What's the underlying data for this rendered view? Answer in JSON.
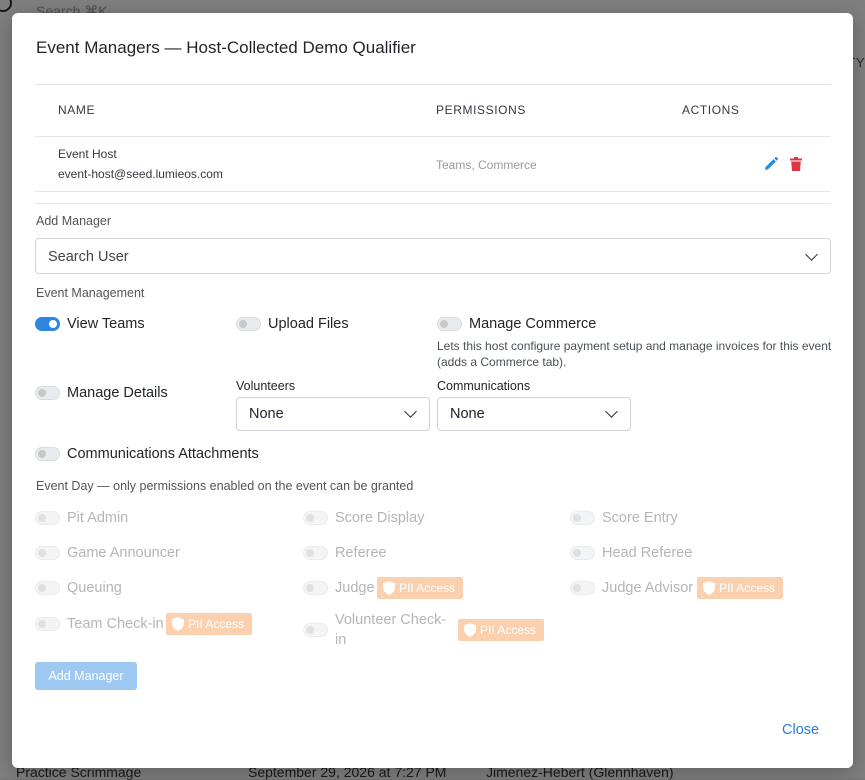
{
  "background": {
    "search_placeholder": "Search ⌘K",
    "col_header": "TY",
    "bottom_row": {
      "name": "Practice Scrimmage",
      "date": "September 29, 2026 at 7:27 PM",
      "location": "Jimenez-Hebert (Glennhaven)"
    }
  },
  "modal": {
    "title": "Event Managers — Host-Collected Demo Qualifier",
    "table": {
      "headers": {
        "name": "NAME",
        "permissions": "PERMISSIONS",
        "actions": "ACTIONS"
      },
      "rows": [
        {
          "name": "Event Host",
          "email": "event-host@seed.lumieos.com",
          "permissions": "Teams, Commerce"
        }
      ]
    },
    "add_manager_label": "Add Manager",
    "search_user_placeholder": "Search User",
    "event_management_label": "Event Management",
    "toggles": {
      "view_teams": {
        "label": "View Teams",
        "on": true
      },
      "upload_files": {
        "label": "Upload Files",
        "on": false
      },
      "manage_commerce": {
        "label": "Manage Commerce",
        "on": false
      },
      "manage_commerce_desc": "Lets this host configure payment setup and manage invoices for this event (adds a Commerce tab).",
      "manage_details": {
        "label": "Manage Details",
        "on": false
      },
      "comm_attachments": {
        "label": "Communications Attachments",
        "on": false
      }
    },
    "volunteers": {
      "label": "Volunteers",
      "value": "None"
    },
    "communications": {
      "label": "Communications",
      "value": "None"
    },
    "event_day_label": "Event Day — only permissions enabled on the event can be granted",
    "event_day": {
      "pit_admin": "Pit Admin",
      "score_display": "Score Display",
      "score_entry": "Score Entry",
      "game_announcer": "Game Announcer",
      "referee": "Referee",
      "head_referee": "Head Referee",
      "queuing": "Queuing",
      "judge": "Judge",
      "judge_advisor": "Judge Advisor",
      "team_checkin": "Team Check-in",
      "volunteer_checkin_1": "Volunteer Check-",
      "volunteer_checkin_2": "in"
    },
    "pii_label": "PII Access",
    "add_button": "Add Manager",
    "close_button": "Close",
    "colors": {
      "primary": "#2e86de",
      "danger": "#dc3545",
      "pii": "#fbd0ae"
    }
  }
}
